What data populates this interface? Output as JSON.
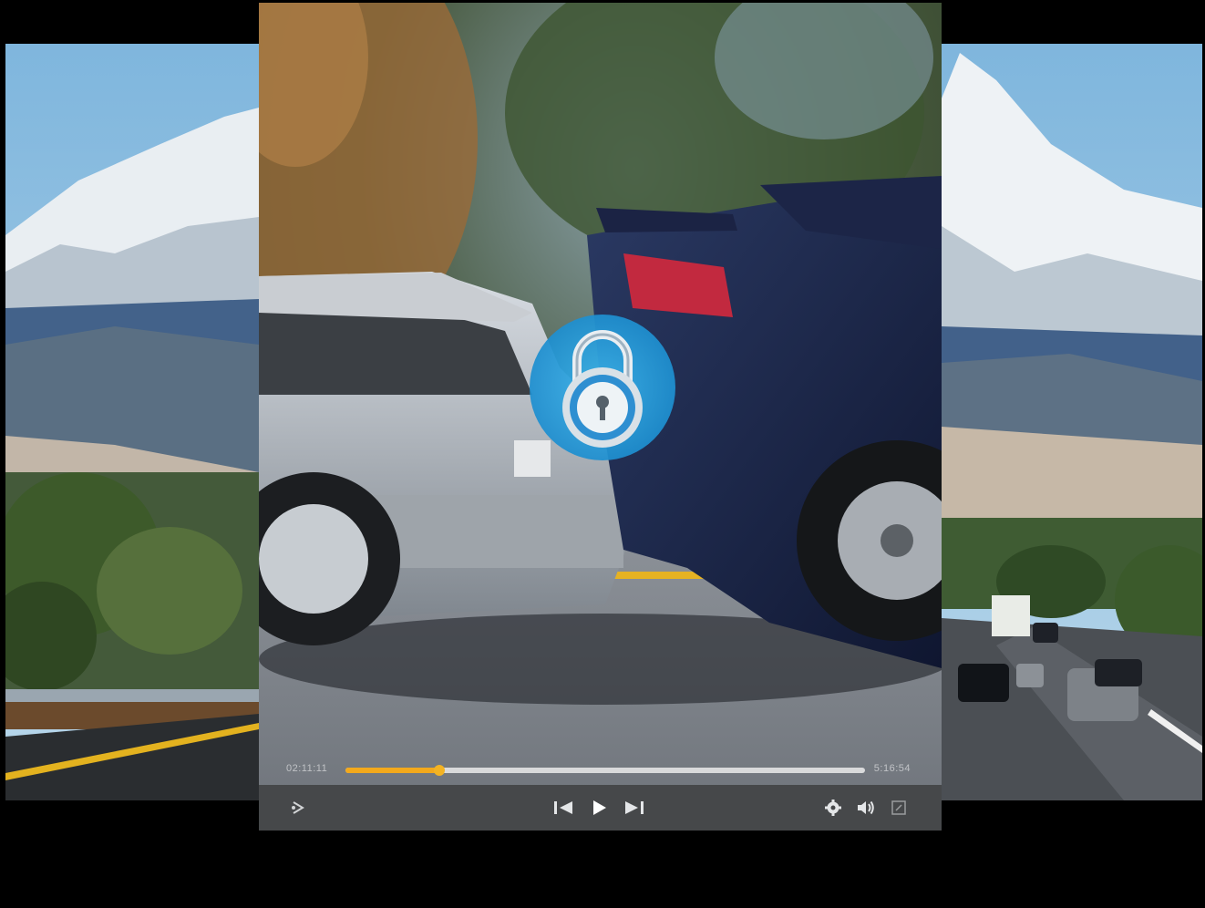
{
  "player": {
    "time_elapsed": "02:11:11",
    "time_total": "5:16:54",
    "progress": 0.18,
    "accent_color": "#f3a91c",
    "bar_color": "#46484a"
  },
  "overlay": {
    "icon": "padlock-icon",
    "color": "#2aa3dc"
  },
  "controls": {
    "left": [
      "share-icon"
    ],
    "center": [
      "previous-icon",
      "play-icon",
      "next-icon"
    ],
    "right": [
      "settings-icon",
      "volume-icon",
      "fullscreen-icon"
    ]
  }
}
